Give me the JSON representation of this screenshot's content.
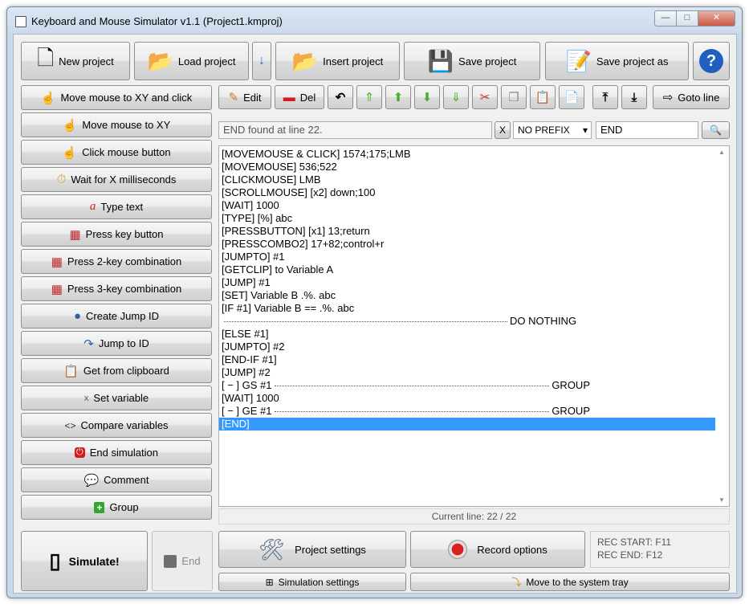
{
  "window": {
    "title": "Keyboard and Mouse Simulator v1.1 (Project1.kmproj)",
    "controls": {
      "minimize": "—",
      "maximize": "□",
      "close": "✕"
    }
  },
  "toolbar": {
    "new_project": "New project",
    "load_project": "Load project",
    "load_dropdown": "↓",
    "insert_project": "Insert project",
    "save_project": "Save project",
    "save_project_as": "Save project as",
    "help": "?"
  },
  "sidebar": {
    "items": [
      {
        "label": "Move mouse to XY and click",
        "icon": "☝"
      },
      {
        "label": "Move mouse to XY",
        "icon": "☝"
      },
      {
        "label": "Click mouse button",
        "icon": "☝"
      },
      {
        "label": "Wait for X milliseconds",
        "icon": "⏱"
      },
      {
        "label": "Type text",
        "icon": "a"
      },
      {
        "label": "Press key button",
        "icon": "▦"
      },
      {
        "label": "Press 2-key combination",
        "icon": "▦"
      },
      {
        "label": "Press 3-key combination",
        "icon": "▦"
      },
      {
        "label": "Create Jump ID",
        "icon": "●"
      },
      {
        "label": "Jump to ID",
        "icon": "↷"
      },
      {
        "label": "Get from clipboard",
        "icon": "📋"
      },
      {
        "label": "Set variable",
        "icon": "x"
      },
      {
        "label": "Compare variables",
        "icon": "<>"
      },
      {
        "label": "End simulation",
        "icon": "⏻"
      },
      {
        "label": "Comment",
        "icon": "💬"
      },
      {
        "label": "Group",
        "icon": "+"
      }
    ]
  },
  "edit_toolbar": {
    "edit": "Edit",
    "del": "Del",
    "goto_line": "Goto line"
  },
  "search": {
    "status": "END found at line 22.",
    "clear": "X",
    "prefix": "NO PREFIX",
    "prefix_arrow": "▾",
    "query": "END",
    "search_icon": "🔍"
  },
  "script": {
    "lines": [
      {
        "text": "[MOVEMOUSE & CLICK] 1574;175;LMB"
      },
      {
        "text": "[MOVEMOUSE] 536;522"
      },
      {
        "text": "[CLICKMOUSE] LMB"
      },
      {
        "text": "[SCROLLMOUSE] [x2] down;100"
      },
      {
        "text": "[WAIT] 1000"
      },
      {
        "text": "[TYPE] [%] abc"
      },
      {
        "text": "[PRESSBUTTON] [x1] 13;return"
      },
      {
        "text": "[PRESSCOMBO2] 17+82;control+r"
      },
      {
        "text": "[JUMPTO] #1"
      },
      {
        "text": "[GETCLIP] to Variable A"
      },
      {
        "text": "[JUMP] #1"
      },
      {
        "text": "[SET] Variable B .%. abc"
      },
      {
        "text": "[IF #1] Variable B == .%. abc"
      },
      {
        "text": "",
        "suffix": "DO NOTHING"
      },
      {
        "text": "[ELSE #1]"
      },
      {
        "text": "[JUMPTO] #2"
      },
      {
        "text": "[END-IF #1]"
      },
      {
        "text": "[JUMP] #2"
      },
      {
        "text": "[ − ] GS #1",
        "suffix": "GROUP"
      },
      {
        "text": "[WAIT] 1000"
      },
      {
        "text": "[ − ] GE #1",
        "suffix": "GROUP"
      },
      {
        "text": "[END]",
        "selected": true
      }
    ],
    "current_line": "Current line: 22 / 22"
  },
  "bottom": {
    "simulate": "Simulate!",
    "end": "End",
    "project_settings": "Project settings",
    "record_options": "Record options",
    "rec_start": "REC START: F11",
    "rec_end": "REC END: F12",
    "simulation_settings": "Simulation settings",
    "move_to_tray": "Move to the system tray"
  },
  "colors": {
    "selection": "#3399ff",
    "record_red": "#d9201c",
    "help_blue": "#1f5fbf",
    "arrow_green": "#4caf2a",
    "arrow_black": "#111111"
  }
}
